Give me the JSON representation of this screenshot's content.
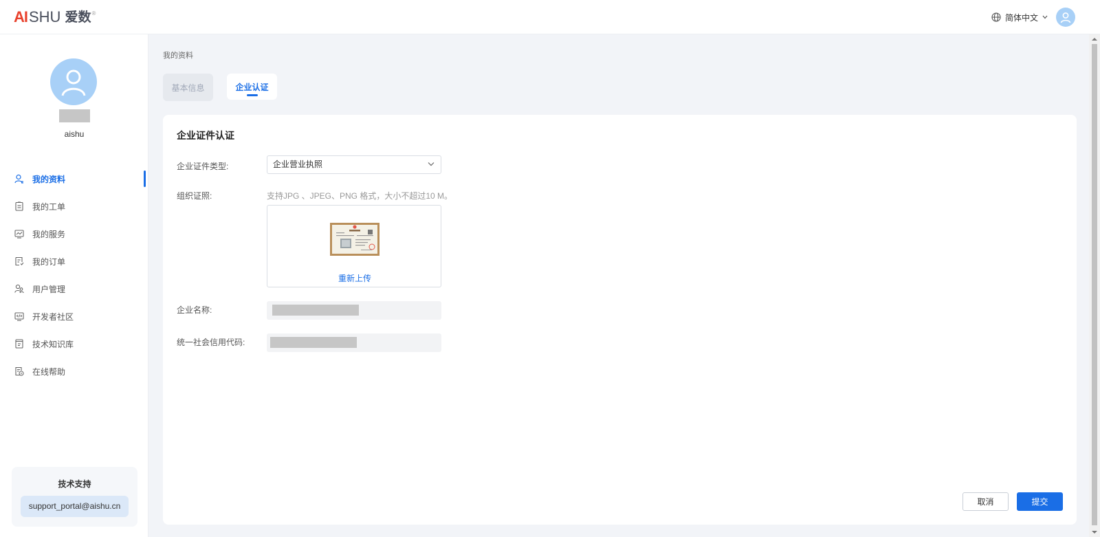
{
  "header": {
    "logo_ai": "AI",
    "logo_shu": "SHU",
    "logo_cn": "爱数",
    "logo_reg": "®",
    "language": "简体中文"
  },
  "sidebar": {
    "username": "aishu",
    "items": [
      {
        "label": "我的资料",
        "icon": "user-profile-icon",
        "active": true
      },
      {
        "label": "我的工单",
        "icon": "ticket-icon"
      },
      {
        "label": "我的服务",
        "icon": "service-icon"
      },
      {
        "label": "我的订单",
        "icon": "order-icon"
      },
      {
        "label": "用户管理",
        "icon": "users-icon"
      },
      {
        "label": "开发者社区",
        "icon": "code-icon"
      },
      {
        "label": "技术知识库",
        "icon": "knowledge-icon"
      },
      {
        "label": "在线帮助",
        "icon": "help-icon"
      }
    ],
    "support": {
      "title": "技术支持",
      "email": "support_portal@aishu.cn"
    }
  },
  "breadcrumb": "我的资料",
  "tabs": [
    {
      "label": "基本信息",
      "active": false
    },
    {
      "label": "企业认证",
      "active": true
    }
  ],
  "form": {
    "title": "企业证件认证",
    "cert_type_label": "企业证件类型:",
    "cert_type_value": "企业营业执照",
    "org_cert_label": "组织证照:",
    "org_cert_hint": "支持JPG 、JPEG、PNG 格式，大小不超过10 M。",
    "reupload": "重新上传",
    "company_name_label": "企业名称:",
    "credit_code_label": "统一社会信用代码:"
  },
  "buttons": {
    "cancel": "取消",
    "submit": "提交"
  },
  "colors": {
    "accent": "#1a6ee6",
    "avatar": "#a8d0f7",
    "logo_red": "#e8412c"
  }
}
